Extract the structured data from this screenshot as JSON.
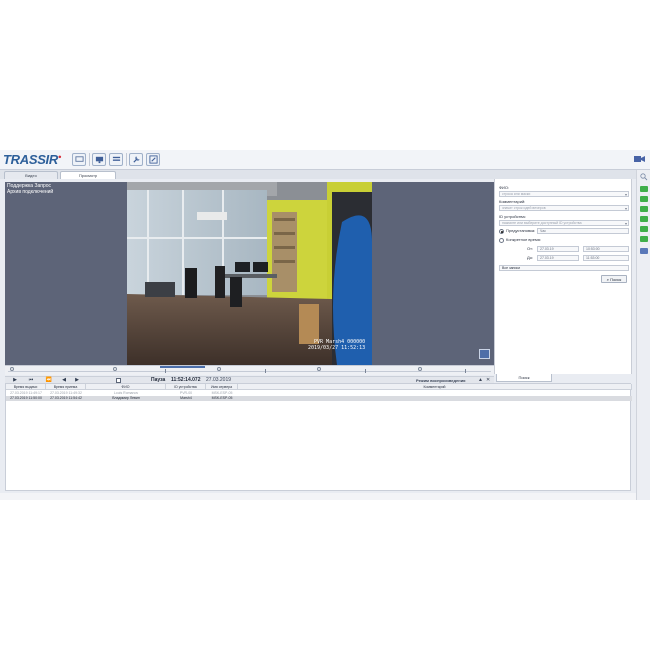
{
  "app": {
    "logo": "TRASSIR"
  },
  "tabs": [
    {
      "label": "Видео"
    },
    {
      "label": "Просмотр"
    }
  ],
  "video": {
    "osd_left_line1": "Поддержка Запрос",
    "osd_left_line2": "Архив подключений",
    "osd_line1": "PVR  Marsh4  000000",
    "osd_line2": "2019/03/27  11:52:13"
  },
  "playback": {
    "state": "Пауза",
    "time": "11:52:14.072",
    "date": "27.03.2019",
    "mode": "Режим воспроизведения",
    "play": "▶",
    "first": "⏮",
    "prev": "⏪",
    "step_back": "◀",
    "step_fwd": "▶",
    "up": "▲",
    "close": "✕"
  },
  "search": {
    "fio_label": "ФИО:",
    "fio_placeholder": "строка или маски",
    "comment_label": "Комментарий:",
    "comment_placeholder": "значит строк идей вечеров",
    "device_label": "ID устройства:",
    "device_placeholder": "нажмите или выберите доступный ID устройства",
    "radio_preset": "Предустановка:",
    "preset_value": "Час",
    "radio_specific": "Конкретное время:",
    "from_label": "От:",
    "from_date": "27.03.19",
    "from_time": "10:53:00",
    "to_label": "До:",
    "to_date": "27.03.19",
    "to_time": "11:53:00",
    "records_value": "Все записи",
    "search_button": "Поиск",
    "panel_tab": "Поиск"
  },
  "table": {
    "columns": [
      "Время выдачи",
      "Время приема",
      "ФИО",
      "ID устройства",
      "Имя сервера",
      "Комментарий"
    ],
    "rows": [
      [
        "27.03.2019 11:49:17",
        "27.03.2019 11:49:32",
        "Louis Romanov",
        "PVR-00",
        "MSK-ESP-05",
        ""
      ],
      [
        "27.03.2019 11:50:00",
        "27.03.2019 11:54:42",
        "Владимир Левин",
        "Marsh4",
        "MSK-ESP-05",
        ""
      ]
    ]
  },
  "colors": {
    "accent": "#4b6eaa",
    "brand": "#2d5f9a",
    "status_green": "#3fae4a"
  }
}
